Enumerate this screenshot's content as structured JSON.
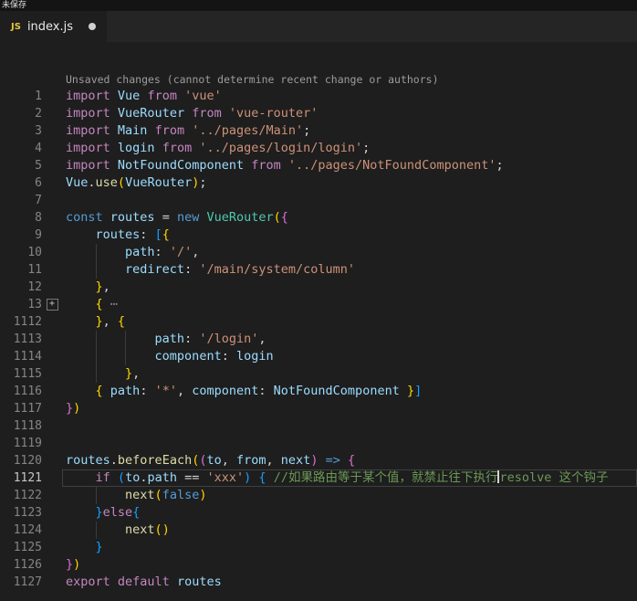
{
  "window": {
    "unsaved_label": "未保存"
  },
  "tab": {
    "icon_label": "JS",
    "title": "index.js",
    "modified": true
  },
  "editor": {
    "codelens": "Unsaved changes (cannot determine recent change or authors)",
    "fold_icon": "+",
    "palette": {
      "kw": "#c586c0",
      "def": "#569cd6",
      "var": "#9cdcfe",
      "cls": "#4ec9b0",
      "fn": "#dcdcaa",
      "str": "#ce9178",
      "pun": "#d4d4d4",
      "b1": "#ffd700",
      "b2": "#da70d6",
      "b3": "#179fff",
      "com": "#6a9955",
      "fold": "#868686",
      "editor_bg": "#1e1e1e",
      "tabbar_bg": "#252526",
      "line_number": "#858585",
      "current_line_number": "#c6c6c6"
    },
    "lines": [
      {
        "num": "1",
        "tokens": [
          [
            "kw",
            "import"
          ],
          [
            "pun",
            " "
          ],
          [
            "var",
            "Vue"
          ],
          [
            "pun",
            " "
          ],
          [
            "kw",
            "from"
          ],
          [
            "pun",
            " "
          ],
          [
            "str",
            "'vue'"
          ]
        ]
      },
      {
        "num": "2",
        "tokens": [
          [
            "kw",
            "import"
          ],
          [
            "pun",
            " "
          ],
          [
            "var",
            "VueRouter"
          ],
          [
            "pun",
            " "
          ],
          [
            "kw",
            "from"
          ],
          [
            "pun",
            " "
          ],
          [
            "str",
            "'vue-router'"
          ]
        ]
      },
      {
        "num": "3",
        "tokens": [
          [
            "kw",
            "import"
          ],
          [
            "pun",
            " "
          ],
          [
            "var",
            "Main"
          ],
          [
            "pun",
            " "
          ],
          [
            "kw",
            "from"
          ],
          [
            "pun",
            " "
          ],
          [
            "str",
            "'../pages/Main'"
          ],
          [
            "pun",
            ";"
          ]
        ]
      },
      {
        "num": "4",
        "tokens": [
          [
            "kw",
            "import"
          ],
          [
            "pun",
            " "
          ],
          [
            "var",
            "login"
          ],
          [
            "pun",
            " "
          ],
          [
            "kw",
            "from"
          ],
          [
            "pun",
            " "
          ],
          [
            "str",
            "'../pages/login/login'"
          ],
          [
            "pun",
            ";"
          ]
        ]
      },
      {
        "num": "5",
        "tokens": [
          [
            "kw",
            "import"
          ],
          [
            "pun",
            " "
          ],
          [
            "var",
            "NotFoundComponent"
          ],
          [
            "pun",
            " "
          ],
          [
            "kw",
            "from"
          ],
          [
            "pun",
            " "
          ],
          [
            "str",
            "'../pages/NotFoundComponent'"
          ],
          [
            "pun",
            ";"
          ]
        ]
      },
      {
        "num": "6",
        "tokens": [
          [
            "var",
            "Vue"
          ],
          [
            "pun",
            "."
          ],
          [
            "fn",
            "use"
          ],
          [
            "b1",
            "("
          ],
          [
            "var",
            "VueRouter"
          ],
          [
            "b1",
            ")"
          ],
          [
            "pun",
            ";"
          ]
        ]
      },
      {
        "num": "7",
        "tokens": []
      },
      {
        "num": "8",
        "tokens": [
          [
            "def",
            "const"
          ],
          [
            "pun",
            " "
          ],
          [
            "var",
            "routes"
          ],
          [
            "pun",
            " = "
          ],
          [
            "def",
            "new"
          ],
          [
            "pun",
            " "
          ],
          [
            "cls",
            "VueRouter"
          ],
          [
            "b1",
            "("
          ],
          [
            "b2",
            "{"
          ]
        ]
      },
      {
        "num": "9",
        "tokens": [
          [
            "pun",
            "    "
          ],
          [
            "var",
            "routes"
          ],
          [
            "pun",
            ": "
          ],
          [
            "b3",
            "["
          ],
          [
            "b1",
            "{"
          ]
        ]
      },
      {
        "num": "10",
        "guides": [
          4
        ],
        "tokens": [
          [
            "pun",
            "        "
          ],
          [
            "var",
            "path"
          ],
          [
            "pun",
            ": "
          ],
          [
            "str",
            "'/'"
          ],
          [
            "pun",
            ","
          ]
        ]
      },
      {
        "num": "11",
        "guides": [
          4
        ],
        "tokens": [
          [
            "pun",
            "        "
          ],
          [
            "var",
            "redirect"
          ],
          [
            "pun",
            ": "
          ],
          [
            "str",
            "'/main/system/column'"
          ]
        ]
      },
      {
        "num": "12",
        "tokens": [
          [
            "pun",
            "    "
          ],
          [
            "b1",
            "}"
          ],
          [
            "pun",
            ","
          ]
        ]
      },
      {
        "num": "13",
        "fold": true,
        "tokens": [
          [
            "pun",
            "    "
          ],
          [
            "b1",
            "{"
          ],
          [
            "pun",
            " "
          ],
          [
            "fold",
            "⋯"
          ]
        ]
      },
      {
        "num": "1112",
        "tokens": [
          [
            "pun",
            "    "
          ],
          [
            "b1",
            "}"
          ],
          [
            "pun",
            ", "
          ],
          [
            "b1",
            "{"
          ]
        ]
      },
      {
        "num": "1113",
        "guides": [
          4,
          8
        ],
        "tokens": [
          [
            "pun",
            "            "
          ],
          [
            "var",
            "path"
          ],
          [
            "pun",
            ": "
          ],
          [
            "str",
            "'/login'"
          ],
          [
            "pun",
            ","
          ]
        ]
      },
      {
        "num": "1114",
        "guides": [
          4,
          8
        ],
        "tokens": [
          [
            "pun",
            "            "
          ],
          [
            "var",
            "component"
          ],
          [
            "pun",
            ": "
          ],
          [
            "var",
            "login"
          ]
        ]
      },
      {
        "num": "1115",
        "guides": [
          4
        ],
        "tokens": [
          [
            "pun",
            "        "
          ],
          [
            "b1",
            "}"
          ],
          [
            "pun",
            ","
          ]
        ]
      },
      {
        "num": "1116",
        "tokens": [
          [
            "pun",
            "    "
          ],
          [
            "b1",
            "{"
          ],
          [
            "pun",
            " "
          ],
          [
            "var",
            "path"
          ],
          [
            "pun",
            ": "
          ],
          [
            "str",
            "'*'"
          ],
          [
            "pun",
            ", "
          ],
          [
            "var",
            "component"
          ],
          [
            "pun",
            ": "
          ],
          [
            "var",
            "NotFoundComponent"
          ],
          [
            "pun",
            " "
          ],
          [
            "b1",
            "}"
          ],
          [
            "b3",
            "]"
          ]
        ]
      },
      {
        "num": "1117",
        "tokens": [
          [
            "b2",
            "}"
          ],
          [
            "b1",
            ")"
          ]
        ]
      },
      {
        "num": "1118",
        "tokens": []
      },
      {
        "num": "1119",
        "tokens": []
      },
      {
        "num": "1120",
        "tokens": [
          [
            "var",
            "routes"
          ],
          [
            "pun",
            "."
          ],
          [
            "fn",
            "beforeEach"
          ],
          [
            "b1",
            "("
          ],
          [
            "b2",
            "("
          ],
          [
            "var",
            "to"
          ],
          [
            "pun",
            ", "
          ],
          [
            "var",
            "from"
          ],
          [
            "pun",
            ", "
          ],
          [
            "var",
            "next"
          ],
          [
            "b2",
            ")"
          ],
          [
            "pun",
            " "
          ],
          [
            "def",
            "=>"
          ],
          [
            "pun",
            " "
          ],
          [
            "b2",
            "{"
          ]
        ]
      },
      {
        "num": "1121",
        "current": true,
        "tokens": [
          [
            "pun",
            "    "
          ],
          [
            "kw",
            "if"
          ],
          [
            "pun",
            " "
          ],
          [
            "b3",
            "("
          ],
          [
            "var",
            "to"
          ],
          [
            "pun",
            "."
          ],
          [
            "var",
            "path"
          ],
          [
            "pun",
            " == "
          ],
          [
            "str",
            "'xxx'"
          ],
          [
            "b3",
            ")"
          ],
          [
            "pun",
            " "
          ],
          [
            "b3",
            "{"
          ],
          [
            "pun",
            " "
          ],
          [
            "com",
            "//如果路由等于某个值，就禁止往下执行"
          ],
          [
            "cursor",
            ""
          ],
          [
            "com",
            "resolve 这个钩子"
          ]
        ]
      },
      {
        "num": "1122",
        "guides": [
          4
        ],
        "tokens": [
          [
            "pun",
            "        "
          ],
          [
            "fn",
            "next"
          ],
          [
            "b1",
            "("
          ],
          [
            "def",
            "false"
          ],
          [
            "b1",
            ")"
          ]
        ]
      },
      {
        "num": "1123",
        "tokens": [
          [
            "pun",
            "    "
          ],
          [
            "b3",
            "}"
          ],
          [
            "kw",
            "else"
          ],
          [
            "b3",
            "{"
          ]
        ]
      },
      {
        "num": "1124",
        "guides": [
          4
        ],
        "tokens": [
          [
            "pun",
            "        "
          ],
          [
            "fn",
            "next"
          ],
          [
            "b1",
            "("
          ],
          [
            "b1",
            ")"
          ]
        ]
      },
      {
        "num": "1125",
        "tokens": [
          [
            "pun",
            "    "
          ],
          [
            "b3",
            "}"
          ]
        ]
      },
      {
        "num": "1126",
        "tokens": [
          [
            "b2",
            "}"
          ],
          [
            "b1",
            ")"
          ]
        ]
      },
      {
        "num": "1127",
        "tokens": [
          [
            "kw",
            "export"
          ],
          [
            "pun",
            " "
          ],
          [
            "kw",
            "default"
          ],
          [
            "pun",
            " "
          ],
          [
            "var",
            "routes"
          ]
        ]
      }
    ]
  }
}
